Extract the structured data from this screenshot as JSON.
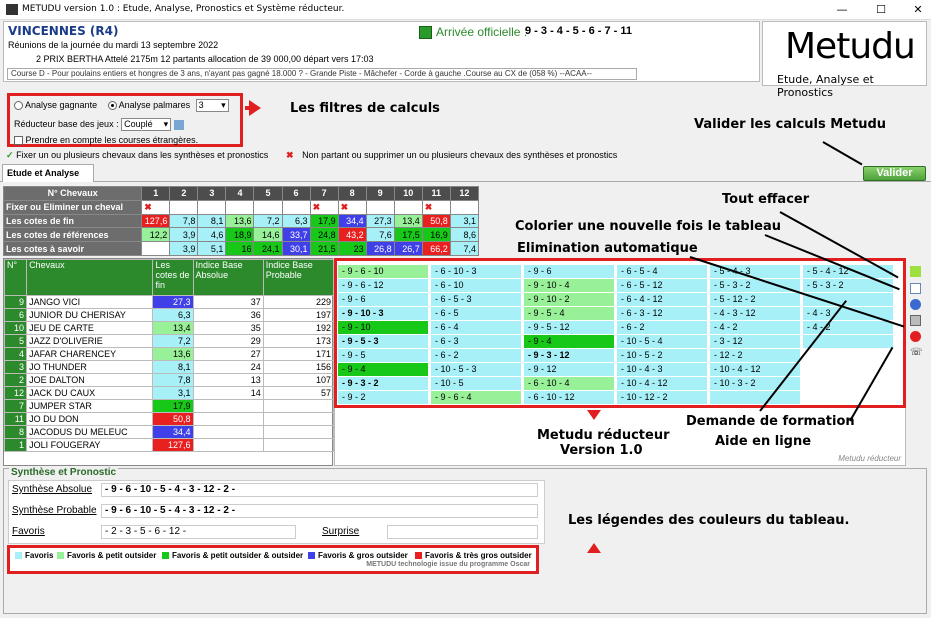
{
  "window": {
    "title": "METUDU version 1.0  : Etude, Analyse,  Pronostics et Système réducteur.",
    "minimize": "—",
    "maximize": "☐",
    "close": "✕"
  },
  "race": {
    "hippodrome": "VINCENNES (R4)",
    "arrivee_label": "Arrivée officielle :",
    "arrivee_value": "9 - 3 - 4 - 5 - 6 - 7 - 11",
    "reunions": "Réunions de la journée du mardi 13 septembre 2022",
    "prix": "2 PRIX BERTHA Attelé 2175m 12 partants allocation de 39 000,00 départ vers 17:03",
    "conditions": "Course D - Pour poulains entiers et hongres de 3 ans, n'ayant pas gagné 18.000 ? - Grande Piste - Mâchefer - Corde à gauche .Course au CX de (058 %)  --ACAA--"
  },
  "logo": {
    "title": "Metudu",
    "subtitle": "Etude, Analyse et Pronostics"
  },
  "filters": {
    "analyse_gagnante": "Analyse gagnante",
    "analyse_palmares": "Analyse palmares",
    "palmares_value": "3",
    "reducteur_label": "Réducteur base des jeux :",
    "reducteur_value": "Couplé",
    "etrangeres": "Prendre en compte les courses étrangères."
  },
  "options": {
    "fixer": "Fixer un ou plusieurs chevaux dans les synthèses et pronostics",
    "non_partant": "Non partant ou supprimer un ou plusieurs chevaux des synthèses et pronostics"
  },
  "annotations": {
    "filtres": "Les filtres de calculs",
    "valider": "Valider les calculs Metudu",
    "tout_effacer": "Tout effacer",
    "colorier": "Colorier une nouvelle fois le tableau",
    "elimination": "Elimination automatique",
    "reducteur_1": "Metudu réducteur",
    "reducteur_2": "Version 1.0",
    "formation": "Demande de formation",
    "aide": "Aide en ligne",
    "legendes": "Les légendes des couleurs du tableau."
  },
  "tab": {
    "label": "Etude et Analyse"
  },
  "validate_button": "Valider",
  "numtable": {
    "header": "N° Chevaux",
    "cols": [
      "1",
      "2",
      "3",
      "4",
      "5",
      "6",
      "7",
      "8",
      "9",
      "10",
      "11",
      "12"
    ],
    "rows": [
      {
        "label": "Fixer ou Eliminer un cheval",
        "values": [
          "",
          "",
          "",
          "",
          "",
          "",
          "",
          "",
          "",
          "",
          "",
          ""
        ],
        "marks": [
          1,
          0,
          0,
          0,
          0,
          0,
          1,
          1,
          0,
          0,
          1,
          0
        ]
      },
      {
        "label": "Les cotes de fin",
        "values": [
          "127,6",
          "7,8",
          "8,1",
          "13,6",
          "7,2",
          "6,3",
          "17,9",
          "34,4",
          "27,3",
          "13,4",
          "50,8",
          "3,1"
        ],
        "colors": [
          "#e82020",
          "#a8f0f8",
          "#a8f0f8",
          "#98f098",
          "#a8f0f8",
          "#a8f0f8",
          "#18c818",
          "#4040e8",
          "#a8f0f8",
          "#98f098",
          "#e82020",
          "#a8f0f8"
        ]
      },
      {
        "label": "Les cotes de références",
        "values": [
          "12,2",
          "3,9",
          "4,6",
          "18,9",
          "14,6",
          "33,7",
          "24,8",
          "43,2",
          "7,6",
          "17,5",
          "16,9",
          "8,6"
        ],
        "colors": [
          "#98f098",
          "#a8f0f8",
          "#a8f0f8",
          "#18c818",
          "#98f098",
          "#4040e8",
          "#18c818",
          "#e82020",
          "#a8f0f8",
          "#18c818",
          "#18c818",
          "#a8f0f8"
        ]
      },
      {
        "label": "Les cotes à savoir",
        "values": [
          "",
          "3,9",
          "5,1",
          "16",
          "24,1",
          "30,1",
          "21,5",
          "23",
          "26,8",
          "26,7",
          "66,2",
          "7,4"
        ],
        "colors": [
          "#fff",
          "#a8f0f8",
          "#a8f0f8",
          "#18c818",
          "#18c818",
          "#4040e8",
          "#18c818",
          "#18c818",
          "#4040e8",
          "#4040e8",
          "#e82020",
          "#a8f0f8"
        ]
      }
    ]
  },
  "horses": {
    "headers": [
      "N°",
      "Chevaux",
      "Les cotes de fin",
      "Indice Base Absolue",
      "Indice Base Probable"
    ],
    "rows": [
      {
        "n": "9",
        "name": "JANGO VICI",
        "cote": "27,3",
        "abs": "37",
        "prob": "229",
        "color": "#4040e8"
      },
      {
        "n": "6",
        "name": "JUNIOR DU CHERISAY",
        "cote": "6,3",
        "abs": "36",
        "prob": "197",
        "color": "#a8f0f8"
      },
      {
        "n": "10",
        "name": "JEU DE CARTE",
        "cote": "13,4",
        "abs": "35",
        "prob": "192",
        "color": "#98f098"
      },
      {
        "n": "5",
        "name": "JAZZ D'OLIVERIE",
        "cote": "7,2",
        "abs": "29",
        "prob": "173",
        "color": "#a8f0f8"
      },
      {
        "n": "4",
        "name": "JAFAR CHARENCEY",
        "cote": "13,6",
        "abs": "27",
        "prob": "171",
        "color": "#98f098"
      },
      {
        "n": "3",
        "name": "JO THUNDER",
        "cote": "8,1",
        "abs": "24",
        "prob": "156",
        "color": "#a8f0f8"
      },
      {
        "n": "2",
        "name": "JOE DALTON",
        "cote": "7,8",
        "abs": "13",
        "prob": "107",
        "color": "#a8f0f8"
      },
      {
        "n": "12",
        "name": "JACK DU CAUX",
        "cote": "3,1",
        "abs": "14",
        "prob": "57",
        "color": "#a8f0f8"
      },
      {
        "n": "7",
        "name": "JUMPER STAR",
        "cote": "17,9",
        "abs": "",
        "prob": "",
        "color": "#18c818"
      },
      {
        "n": "11",
        "name": "JO DU DON",
        "cote": "50,8",
        "abs": "",
        "prob": "",
        "color": "#e82020"
      },
      {
        "n": "8",
        "name": "JACODUS DU MELEUC",
        "cote": "34,4",
        "abs": "",
        "prob": "",
        "color": "#4040e8"
      },
      {
        "n": "1",
        "name": "JOLI FOUGERAY",
        "cote": "127,6",
        "abs": "",
        "prob": "",
        "color": "#e82020"
      }
    ]
  },
  "combos": {
    "columns": [
      [
        {
          "t": "- 9 - 6 - 10",
          "c": "#98f098",
          "b": false
        },
        {
          "t": "- 9 - 6 - 12",
          "c": "#a8f0f8",
          "b": false
        },
        {
          "t": "- 9 - 6",
          "c": "#a8f0f8",
          "b": false
        },
        {
          "t": "- 9 - 10 - 3",
          "c": "#a8f0f8",
          "b": true
        },
        {
          "t": "- 9 - 10",
          "c": "#18c818",
          "b": false
        },
        {
          "t": "- 9 - 5 - 3",
          "c": "#a8f0f8",
          "b": true
        },
        {
          "t": "- 9 - 5",
          "c": "#a8f0f8",
          "b": false
        },
        {
          "t": "- 9 - 4",
          "c": "#18c818",
          "b": false
        },
        {
          "t": "- 9 - 3 - 2",
          "c": "#a8f0f8",
          "b": true
        },
        {
          "t": "- 9 - 2",
          "c": "#a8f0f8",
          "b": false
        }
      ],
      [
        {
          "t": "- 6 - 10 - 3",
          "c": "#a8f0f8",
          "b": false
        },
        {
          "t": "- 6 - 10",
          "c": "#a8f0f8",
          "b": false
        },
        {
          "t": "- 6 - 5 - 3",
          "c": "#a8f0f8",
          "b": false
        },
        {
          "t": "- 6 - 5",
          "c": "#a8f0f8",
          "b": false
        },
        {
          "t": "- 6 - 4",
          "c": "#a8f0f8",
          "b": false
        },
        {
          "t": "- 6 - 3",
          "c": "#a8f0f8",
          "b": false
        },
        {
          "t": "- 6 - 2",
          "c": "#a8f0f8",
          "b": false
        },
        {
          "t": "- 10 - 5 - 3",
          "c": "#a8f0f8",
          "b": false
        },
        {
          "t": "- 10 - 5",
          "c": "#a8f0f8",
          "b": false
        },
        {
          "t": "- 9 - 6 - 4",
          "c": "#98f098",
          "b": false
        }
      ],
      [
        {
          "t": "- 9 - 6",
          "c": "#a8f0f8",
          "b": false
        },
        {
          "t": "- 9 - 10 - 4",
          "c": "#98f098",
          "b": false
        },
        {
          "t": "- 9 - 10 - 2",
          "c": "#98f098",
          "b": false
        },
        {
          "t": "- 9 - 5 - 4",
          "c": "#98f098",
          "b": false
        },
        {
          "t": "- 9 - 5 - 12",
          "c": "#a8f0f8",
          "b": false
        },
        {
          "t": "- 9 - 4",
          "c": "#18c818",
          "b": false
        },
        {
          "t": "- 9 - 3 - 12",
          "c": "#a8f0f8",
          "b": true
        },
        {
          "t": "- 9 - 12",
          "c": "#a8f0f8",
          "b": false
        },
        {
          "t": "- 6 - 10 - 4",
          "c": "#98f098",
          "b": false
        },
        {
          "t": "- 6 - 10 - 12",
          "c": "#a8f0f8",
          "b": false
        }
      ],
      [
        {
          "t": "- 6 - 5 - 4",
          "c": "#a8f0f8",
          "b": false
        },
        {
          "t": "- 6 - 5 - 12",
          "c": "#a8f0f8",
          "b": false
        },
        {
          "t": "- 6 - 4 - 12",
          "c": "#a8f0f8",
          "b": false
        },
        {
          "t": "- 6 - 3 - 12",
          "c": "#a8f0f8",
          "b": false
        },
        {
          "t": "- 6 - 2",
          "c": "#a8f0f8",
          "b": false
        },
        {
          "t": "- 10 - 5 - 4",
          "c": "#a8f0f8",
          "b": false
        },
        {
          "t": "- 10 - 5 - 2",
          "c": "#a8f0f8",
          "b": false
        },
        {
          "t": "- 10 - 4 - 3",
          "c": "#a8f0f8",
          "b": false
        },
        {
          "t": "- 10 - 4 - 12",
          "c": "#a8f0f8",
          "b": false
        },
        {
          "t": "- 10 - 12 - 2",
          "c": "#a8f0f8",
          "b": false
        }
      ],
      [
        {
          "t": "- 5 - 4 - 3",
          "c": "#a8f0f8",
          "b": false
        },
        {
          "t": "- 5 - 3 - 2",
          "c": "#a8f0f8",
          "b": false
        },
        {
          "t": "- 5 - 12 - 2",
          "c": "#a8f0f8",
          "b": false
        },
        {
          "t": "- 4 - 3 - 12",
          "c": "#a8f0f8",
          "b": false
        },
        {
          "t": "- 4 - 2",
          "c": "#a8f0f8",
          "b": false
        },
        {
          "t": "- 3 - 12",
          "c": "#a8f0f8",
          "b": false
        },
        {
          "t": "- 12 - 2",
          "c": "#a8f0f8",
          "b": false
        },
        {
          "t": "- 10 - 4 - 12",
          "c": "#a8f0f8",
          "b": false
        },
        {
          "t": "- 10 - 3 - 2",
          "c": "#a8f0f8",
          "b": false
        },
        {
          "t": "",
          "c": "#a8f0f8",
          "b": false
        }
      ],
      [
        {
          "t": "- 5 - 4 - 12",
          "c": "#a8f0f8",
          "b": false
        },
        {
          "t": "- 5 - 3 - 2",
          "c": "#a8f0f8",
          "b": false
        },
        {
          "t": "",
          "c": "#a8f0f8",
          "b": false
        },
        {
          "t": "- 4 - 3",
          "c": "#a8f0f8",
          "b": false
        },
        {
          "t": "- 4 - 2",
          "c": "#a8f0f8",
          "b": false
        },
        {
          "t": "",
          "c": "#a8f0f8",
          "b": false
        },
        {
          "t": "",
          "c": "#fff",
          "b": false
        },
        {
          "t": "",
          "c": "#fff",
          "b": false
        },
        {
          "t": "",
          "c": "#fff",
          "b": false
        },
        {
          "t": "",
          "c": "#fff",
          "b": false
        }
      ]
    ],
    "footer": "Metudu réducteur"
  },
  "synthese": {
    "title": "Synthèse et Pronostic",
    "absolue_label": "Synthèse Absolue",
    "absolue_value": "- 9 - 6 - 10 - 5 - 4 - 3 - 12 - 2 -",
    "probable_label": "Synthèse Probable",
    "probable_value": "- 9 - 6 - 10 - 5 - 4 - 3 - 12 - 2 -",
    "favoris_label": "Favoris",
    "favoris_value": "- 2 - 3 - 5 - 6 - 12 -",
    "surprise_label": "Surprise"
  },
  "legend": {
    "items": [
      {
        "label": "Favoris",
        "color": "#a8f0f8"
      },
      {
        "label": "Favoris & petit outsider",
        "color": "#98f098"
      },
      {
        "label": "Favoris & petit outsider & outsider",
        "color": "#18c818"
      },
      {
        "label": "Favoris & gros outsider",
        "color": "#4040e8"
      },
      {
        "label": "Favoris & très gros outsider",
        "color": "#e82020"
      }
    ],
    "footer": "METUDU technologie issue du programme Oscar"
  }
}
